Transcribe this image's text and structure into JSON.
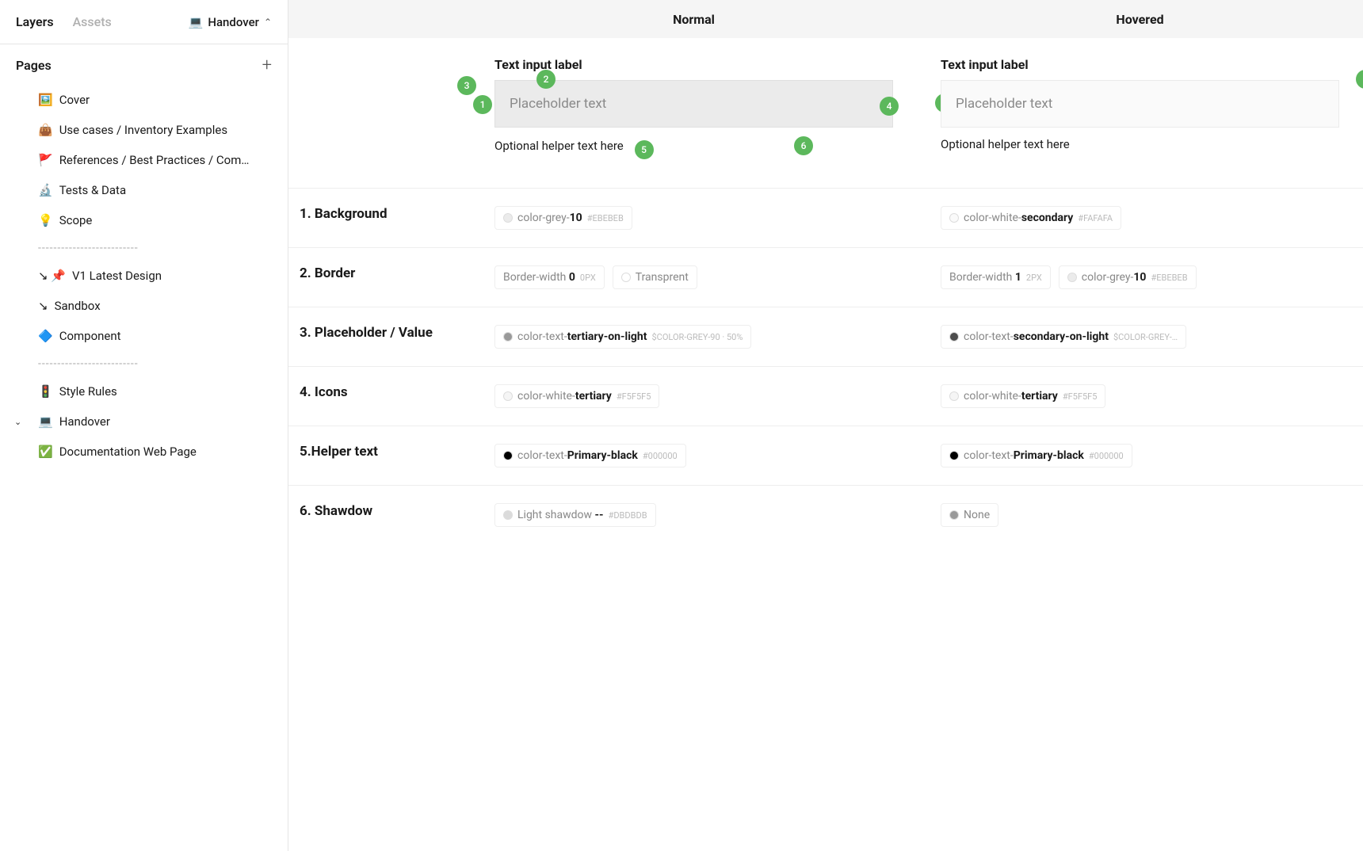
{
  "sidebar": {
    "tabs": {
      "layers": "Layers",
      "assets": "Assets"
    },
    "file": {
      "icon": "💻",
      "name": "Handover"
    },
    "pagesHeader": "Pages",
    "pages": [
      {
        "icon": "🖼️",
        "label": "Cover",
        "type": "item"
      },
      {
        "icon": "👜",
        "label": "Use cases / Inventory Examples",
        "type": "item"
      },
      {
        "icon": "🚩",
        "label": "References  / Best Practices / Com…",
        "type": "item"
      },
      {
        "icon": "🔬",
        "label": "Tests & Data",
        "type": "item"
      },
      {
        "icon": "💡",
        "label": "Scope",
        "type": "item"
      },
      {
        "label": "--------------------------",
        "type": "divider"
      },
      {
        "icon": "↘ 📌",
        "label": "V1  Latest Design",
        "type": "item"
      },
      {
        "icon": "↘",
        "label": "Sandbox",
        "type": "item"
      },
      {
        "icon": "🔷",
        "label": "Component",
        "type": "item"
      },
      {
        "label": "--------------------------",
        "type": "divider"
      },
      {
        "icon": "🚦",
        "label": "Style Rules",
        "type": "item"
      },
      {
        "icon": "💻",
        "label": "Handover",
        "type": "item",
        "expanded": true
      },
      {
        "icon": "✅",
        "label": "Documentation Web Page",
        "type": "item"
      }
    ]
  },
  "columns": {
    "normal": "Normal",
    "hovered": "Hovered"
  },
  "example": {
    "label": "Text input label",
    "placeholder": "Placeholder text",
    "helper": "Optional helper text here"
  },
  "specs": [
    {
      "name": "1. Background",
      "normal": [
        {
          "swatch": "#EBEBEB",
          "pre": "color-grey-",
          "bold": "10",
          "hex": "#EBEBEB"
        }
      ],
      "hovered": [
        {
          "swatch": "#FAFAFA",
          "pre": "color-white-",
          "bold": "secondary",
          "hex": "#FAFAFA"
        }
      ]
    },
    {
      "name": "2. Border",
      "normal": [
        {
          "swatch": "",
          "pre": "Border-width ",
          "bold": "0",
          "hex": "0px"
        },
        {
          "swatch": "#ffffff",
          "pre": "Transprent",
          "bold": "",
          "hex": ""
        }
      ],
      "hovered": [
        {
          "swatch": "",
          "pre": "Border-width ",
          "bold": "1",
          "hex": "2px"
        },
        {
          "swatch": "#EBEBEB",
          "pre": "color-grey-",
          "bold": "10",
          "hex": "#EBEBEB"
        }
      ]
    },
    {
      "name": "3. Placeholder / Value",
      "normal": [
        {
          "swatch": "#999999",
          "pre": "color-text-",
          "bold": "tertiary-on-light",
          "hex": "$COLOR-GREY-90 · 50%"
        }
      ],
      "hovered": [
        {
          "swatch": "#4d4d4d",
          "pre": "color-text-",
          "bold": "secondary-on-light",
          "hex": "$COLOR-GREY-…"
        }
      ]
    },
    {
      "name": "4. Icons",
      "normal": [
        {
          "swatch": "#F5F5F5",
          "pre": "color-white-",
          "bold": "tertiary",
          "hex": "#F5F5F5"
        }
      ],
      "hovered": [
        {
          "swatch": "#F5F5F5",
          "pre": "color-white-",
          "bold": "tertiary",
          "hex": "#F5F5F5"
        }
      ]
    },
    {
      "name": "5.Helper text",
      "normal": [
        {
          "swatch": "#000000",
          "pre": "color-text-",
          "bold": "Primary-black",
          "hex": "#000000"
        }
      ],
      "hovered": [
        {
          "swatch": "#000000",
          "pre": "color-text-",
          "bold": "Primary-black",
          "hex": "#000000"
        }
      ]
    },
    {
      "name": "6. Shawdow",
      "normal": [
        {
          "swatch": "#DBDBDB",
          "pre": "Light shawdow ",
          "bold": "--",
          "hex": "#DBDBDB"
        }
      ],
      "hovered": [
        {
          "swatch": "#999999",
          "pre": "None",
          "bold": "",
          "hex": ""
        }
      ]
    }
  ]
}
